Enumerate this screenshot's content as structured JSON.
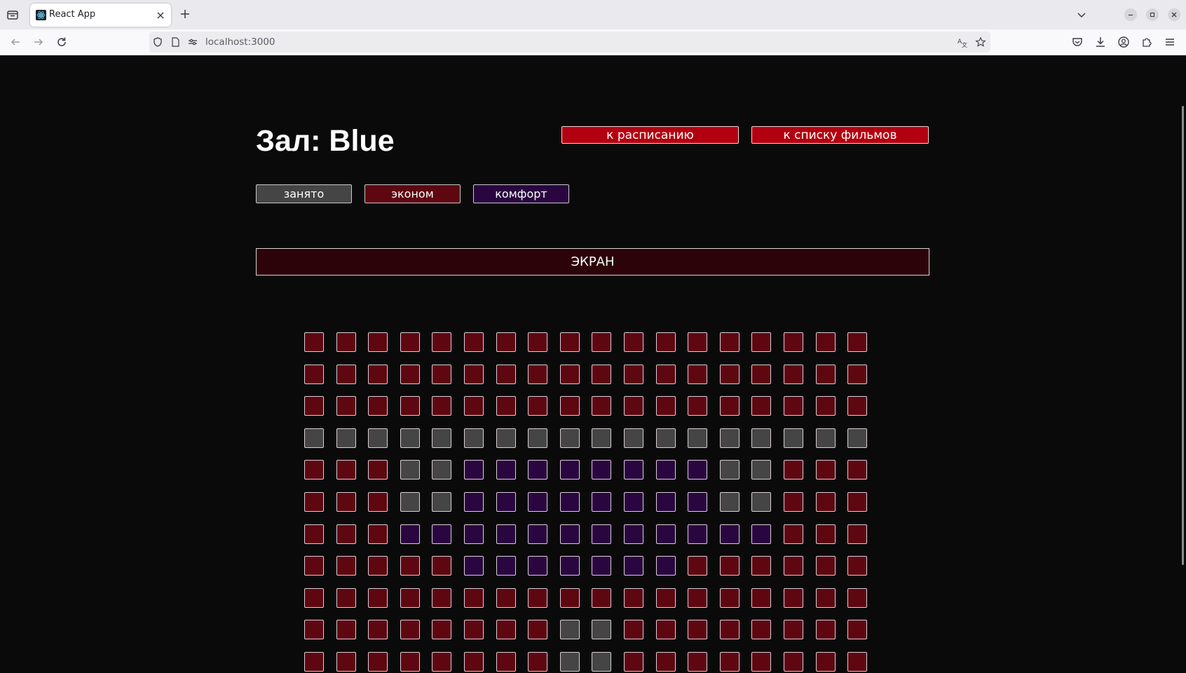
{
  "browser": {
    "tab_title": "React App",
    "url": "localhost:3000"
  },
  "page": {
    "title": "Зал: Blue",
    "links": {
      "schedule": "к расписанию",
      "films": "к списку фильмов"
    },
    "legend": {
      "taken": "занято",
      "economy": "эконом",
      "comfort": "комфорт"
    },
    "screen_label": "ЭКРАН",
    "seat_colors": {
      "economy": "#5e0711",
      "comfort": "#2a0640",
      "taken": "#454545"
    },
    "seat_legend_codes": {
      "E": "economy",
      "C": "comfort",
      "T": "taken"
    },
    "seat_rows": [
      "EEEEEEEEEEEEEEEEEE",
      "EEEEEEEEEEEEEEEEEE",
      "EEEEEEEEEEEEEEEEEE",
      "TTTTTTTTTTTTTTTTTT",
      "EEETTCCCCCCCCTTEEE",
      "EEETTCCCCCCCCTTEEE",
      "EEECCCCCCCCCCCCEEE",
      "EEEEECCCCCCCEEEEEE",
      "EEEEEEEEEEEEEEEEEE",
      "EEEEEEEETTEEEEEEEE",
      "EEEEEEEETTEEEEEEEE"
    ]
  }
}
